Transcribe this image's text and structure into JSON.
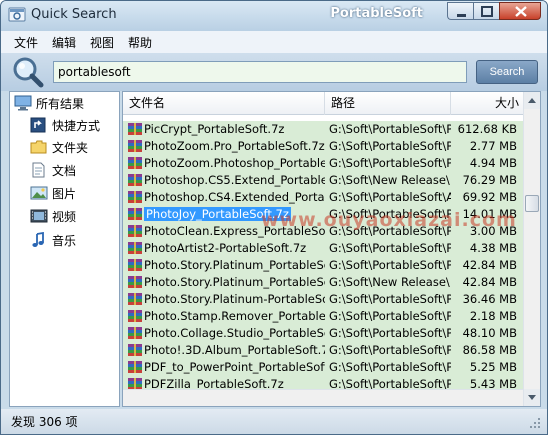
{
  "window": {
    "title": "Quick Search",
    "brand": "PortableSoft"
  },
  "menu": [
    "文件",
    "编辑",
    "视图",
    "帮助"
  ],
  "search": {
    "value": "portablesoft",
    "button_label": "Search"
  },
  "sidebar": {
    "items": [
      {
        "label": "所有结果",
        "icon": "monitor-icon"
      },
      {
        "label": "快捷方式",
        "icon": "shortcut-icon"
      },
      {
        "label": "文件夹",
        "icon": "folder-icon"
      },
      {
        "label": "文档",
        "icon": "document-icon"
      },
      {
        "label": "图片",
        "icon": "picture-icon"
      },
      {
        "label": "视频",
        "icon": "video-icon"
      },
      {
        "label": "音乐",
        "icon": "music-icon"
      }
    ]
  },
  "columns": {
    "name": "文件名",
    "path": "路径",
    "size": "大小"
  },
  "rows": [
    {
      "name": "PicCrypt_PortableSoft.7z",
      "path": "G:\\Soft\\PortableSoft\\P\\",
      "size": "612.68 KB"
    },
    {
      "name": "PhotoZoom.Pro_PortableSoft.7z",
      "path": "G:\\Soft\\PortableSoft\\P\\",
      "size": "2.77 MB"
    },
    {
      "name": "PhotoZoom.Photoshop_PortableS...",
      "path": "G:\\Soft\\PortableSoft\\P\\",
      "size": "4.94 MB"
    },
    {
      "name": "Photoshop.CS5.Extend_PortableS...",
      "path": "G:\\Soft\\New Release\\",
      "size": "76.29 MB"
    },
    {
      "name": "Photoshop.CS4.Extended_Portabl...",
      "path": "G:\\Soft\\PortableSoft\\A\\",
      "size": "69.92 MB"
    },
    {
      "name": "PhotoJoy_PortableSoft.7z",
      "path": "G:\\Soft\\PortableSoft\\P\\",
      "size": "14.01 MB"
    },
    {
      "name": "PhotoClean.Express_PortableSo...",
      "path": "G:\\Soft\\PortableSoft\\P\\",
      "size": "3.00 MB"
    },
    {
      "name": "PhotoArtist2-PortableSoft.7z",
      "path": "G:\\Soft\\PortableSoft\\P\\",
      "size": "4.38 MB"
    },
    {
      "name": "Photo.Story.Platinum_PortableSof...",
      "path": "G:\\Soft\\PortableSoft\\P\\",
      "size": "42.84 MB"
    },
    {
      "name": "Photo.Story.Platinum_PortableSof...",
      "path": "G:\\Soft\\New Release\\",
      "size": "42.84 MB"
    },
    {
      "name": "Photo.Story.Platinum-PortableSof...",
      "path": "G:\\Soft\\PortableSoft\\P\\",
      "size": "36.46 MB"
    },
    {
      "name": "Photo.Stamp.Remover_PortableS...",
      "path": "G:\\Soft\\PortableSoft\\P\\",
      "size": "2.18 MB"
    },
    {
      "name": "Photo.Collage.Studio_PortableSof...",
      "path": "G:\\Soft\\PortableSoft\\P\\",
      "size": "48.10 MB"
    },
    {
      "name": "Photo!.3D.Album_PortableSoft.7z",
      "path": "G:\\Soft\\PortableSoft\\P\\",
      "size": "86.58 MB"
    },
    {
      "name": "PDF_to_PowerPoint_PortableSoft.7z",
      "path": "G:\\Soft\\PortableSoft\\P\\",
      "size": "5.25 MB"
    },
    {
      "name": "PDFZilla_PortableSoft.7z",
      "path": "G:\\Soft\\PortableSoft\\P\\",
      "size": "5.43 MB"
    }
  ],
  "selected_row": 5,
  "watermark": "www.ouyaoxiazai.com",
  "status": {
    "text": "发现 306 项"
  }
}
